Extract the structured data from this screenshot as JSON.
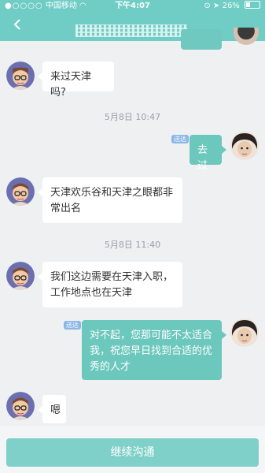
{
  "status_bar": {
    "carrier": "中国移动",
    "time": "下午4:07",
    "battery": "26%"
  },
  "header": {
    "back_icon": "chevron-left-icon"
  },
  "messages": [
    {
      "side": "in",
      "text": "来过天津吗?"
    },
    {
      "type": "timestamp",
      "text": "5月8日 10:47"
    },
    {
      "side": "out",
      "text": "去过",
      "read_tag": "送达"
    },
    {
      "side": "in",
      "text": "天津欢乐谷和天津之眼都非常出名"
    },
    {
      "type": "timestamp",
      "text": "5月8日 11:40"
    },
    {
      "side": "in",
      "text": "我们这边需要在天津入职，工作地点也在天津"
    },
    {
      "side": "out",
      "text": "对不起，您那可能不太适合我，祝您早日找到合适的优秀的人才",
      "read_tag": "送达"
    },
    {
      "side": "in",
      "text": "嗯"
    }
  ],
  "footer": {
    "continue_button": "继续沟通"
  },
  "colors": {
    "accent": "#6fcdc5",
    "outgoing_bubble": "#6cc7bd",
    "incoming_bubble": "#ffffff",
    "read_tag": "#8bb6e6",
    "background": "#eef0f2"
  }
}
